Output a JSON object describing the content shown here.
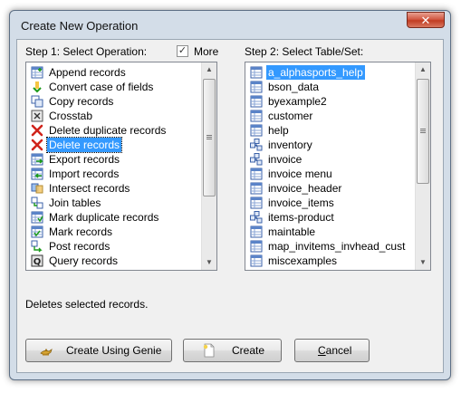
{
  "window": {
    "title": "Create New Operation",
    "close_glyph": "✕"
  },
  "step1": {
    "label": "Step 1: Select Operation:",
    "more_label": "More",
    "more_checked": true,
    "check_glyph": "✓"
  },
  "step2": {
    "label": "Step 2: Select Table/Set:"
  },
  "operations": [
    {
      "label": "Append records",
      "icon": "append-icon"
    },
    {
      "label": "Convert case of fields",
      "icon": "convert-case-icon"
    },
    {
      "label": "Copy records",
      "icon": "copy-icon"
    },
    {
      "label": "Crosstab",
      "icon": "crosstab-icon"
    },
    {
      "label": "Delete duplicate records",
      "icon": "red-x-icon"
    },
    {
      "label": "Delete records",
      "icon": "red-x-icon",
      "selected": true
    },
    {
      "label": "Export records",
      "icon": "export-arrow-icon"
    },
    {
      "label": "Import records",
      "icon": "import-arrow-icon"
    },
    {
      "label": "Intersect records",
      "icon": "intersect-icon"
    },
    {
      "label": "Join tables",
      "icon": "join-icon"
    },
    {
      "label": "Mark duplicate records",
      "icon": "mark-duplicate-icon"
    },
    {
      "label": "Mark records",
      "icon": "mark-icon"
    },
    {
      "label": "Post records",
      "icon": "post-icon"
    },
    {
      "label": "Query records",
      "icon": "query-icon"
    }
  ],
  "tables": [
    {
      "label": "a_alphasports_help",
      "icon": "table-icon",
      "selected": true
    },
    {
      "label": "bson_data",
      "icon": "table-icon"
    },
    {
      "label": "byexample2",
      "icon": "table-icon"
    },
    {
      "label": "customer",
      "icon": "table-icon"
    },
    {
      "label": "help",
      "icon": "table-icon"
    },
    {
      "label": "inventory",
      "icon": "set-icon"
    },
    {
      "label": "invoice",
      "icon": "set-icon"
    },
    {
      "label": "invoice menu",
      "icon": "table-icon"
    },
    {
      "label": "invoice_header",
      "icon": "table-icon"
    },
    {
      "label": "invoice_items",
      "icon": "table-icon"
    },
    {
      "label": "items-product",
      "icon": "set-icon"
    },
    {
      "label": "maintable",
      "icon": "table-icon"
    },
    {
      "label": "map_invitems_invhead_cust",
      "icon": "table-icon"
    },
    {
      "label": "miscexamples",
      "icon": "table-icon"
    }
  ],
  "status_text": "Deletes selected records.",
  "buttons": {
    "genie": {
      "label": "Create Using Genie",
      "icon": "genie-lamp-icon"
    },
    "create": {
      "label": "Create",
      "icon": "new-document-icon"
    },
    "cancel": {
      "label": "Cancel",
      "mnemonic": "C",
      "rest": "ancel"
    }
  },
  "scroll_glyphs": {
    "up": "▲",
    "down": "▼"
  }
}
